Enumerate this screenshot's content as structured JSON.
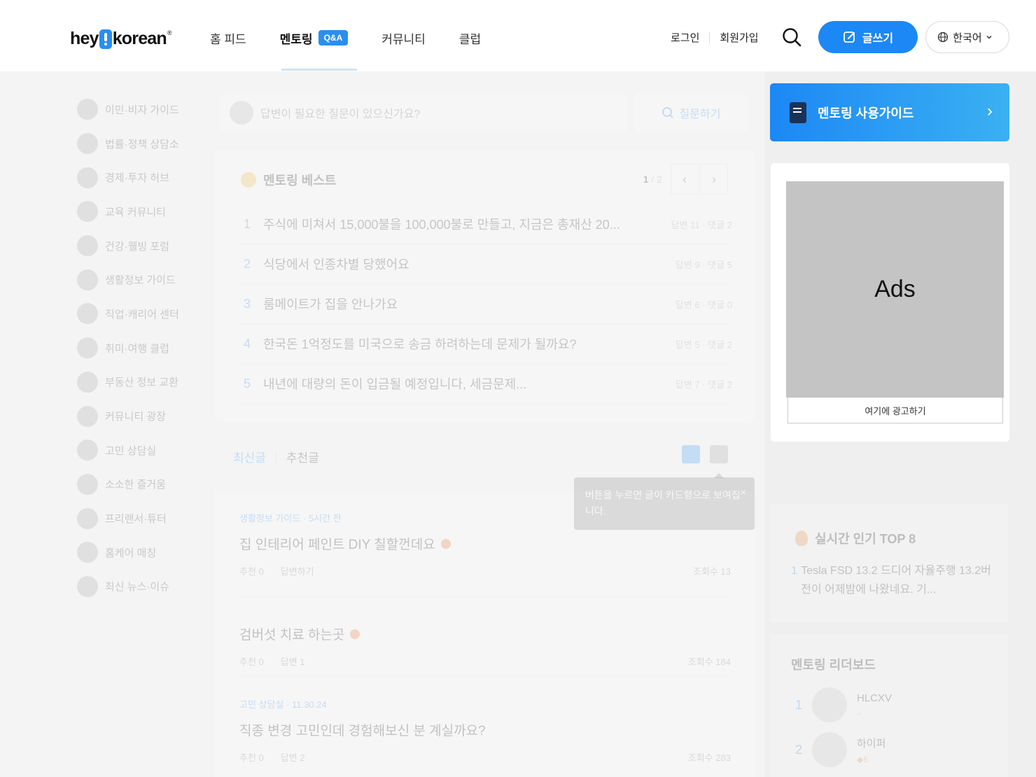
{
  "header": {
    "logo_left": "hey",
    "logo_right": "korean",
    "logo_reg": "®",
    "nav": [
      {
        "label": "홈 피드"
      },
      {
        "label": "멘토링",
        "badge": "Q&A"
      },
      {
        "label": "커뮤니티"
      },
      {
        "label": "클럽"
      }
    ],
    "login": "로그인",
    "signup": "회원가입",
    "write": "글쓰기",
    "language": "한국어",
    "accent_color": "#1c88f5"
  },
  "sidebar": {
    "items": [
      "이민·비자 가이드",
      "법률·정책 상담소",
      "경제·투자 허브",
      "교육 커뮤니티",
      "건강·웰빙 포럼",
      "생활정보 가이드",
      "직업·캐리어 센터",
      "취미·여행 클럽",
      "부동산 정보 교환",
      "커뮤니티 광장",
      "고민 상담실",
      "소소한 즐거움",
      "프리랜서·튜터",
      "홈케어 매칭",
      "최신 뉴스·이슈"
    ]
  },
  "search": {
    "placeholder": "답변이 필요한 질문이 있으신가요?",
    "ask_button": "질문하기"
  },
  "best": {
    "title": "멘토링 베스트",
    "page_current": "1",
    "page_total": "/ 2",
    "rows": [
      {
        "num": "1",
        "text": "주식에 미쳐서 15,000불을 100,000불로 만들고, 지금은 총재산 20...",
        "meta": "답변 11 · 댓글 2"
      },
      {
        "num": "2",
        "text": "식당에서 인종차별 당했어요",
        "meta": "답변 9 · 댓글 5"
      },
      {
        "num": "3",
        "text": "룸메이트가 집을 안나가요",
        "meta": "답변 6 · 댓글 0"
      },
      {
        "num": "4",
        "text": "한국돈 1억정도를 미국으로 송금 하려하는데 문제가 될까요?",
        "meta": "답변 5 · 댓글 2"
      },
      {
        "num": "5",
        "text": "내년에 대량의 돈이 입금될 예정입니다, 세금문제...",
        "meta": "답변 7 · 댓글 2"
      }
    ]
  },
  "tabs": {
    "latest": "최신글",
    "recommended": "추천글"
  },
  "tooltip": {
    "text": "버튼을 누르면 글이 카드형으로 보여집니다.",
    "close": "×"
  },
  "posts": [
    {
      "category": "생활정보 가이드 · 5시간 전",
      "title": "집 인테리어 페인트 DIY 칠할껀데요",
      "recommend": "추천 0",
      "answer": "답변하기",
      "views": "조회수 13"
    },
    {
      "category": "",
      "title": "검버섯 치료 하는곳",
      "recommend": "추천 0",
      "answer": "답변 1",
      "views": "조회수 184"
    },
    {
      "category": "고민 상담실 · 11.30.24",
      "title": "직종 변경 고민인데 경험해보신 분 계실까요?",
      "recommend": "추천 0",
      "answer": "답변 2",
      "views": "조회수 283"
    }
  ],
  "right": {
    "guide": "멘토링 사용가이드",
    "ads": "Ads",
    "ad_link": "여기에 광고하기",
    "top8_title": "실시간 인기 TOP 8",
    "top8_first_num": "1",
    "top8_first": "Tesla FSD 13.2 드디어 자율주행 13.2버전이 어제밤에 나왔네요. 기...",
    "leader_title": "멘토링 리더보드",
    "leaders": [
      {
        "rank": "1",
        "name": "HLCXV",
        "sub": "–"
      },
      {
        "rank": "2",
        "name": "하이퍼",
        "sub": "◆6"
      }
    ]
  }
}
